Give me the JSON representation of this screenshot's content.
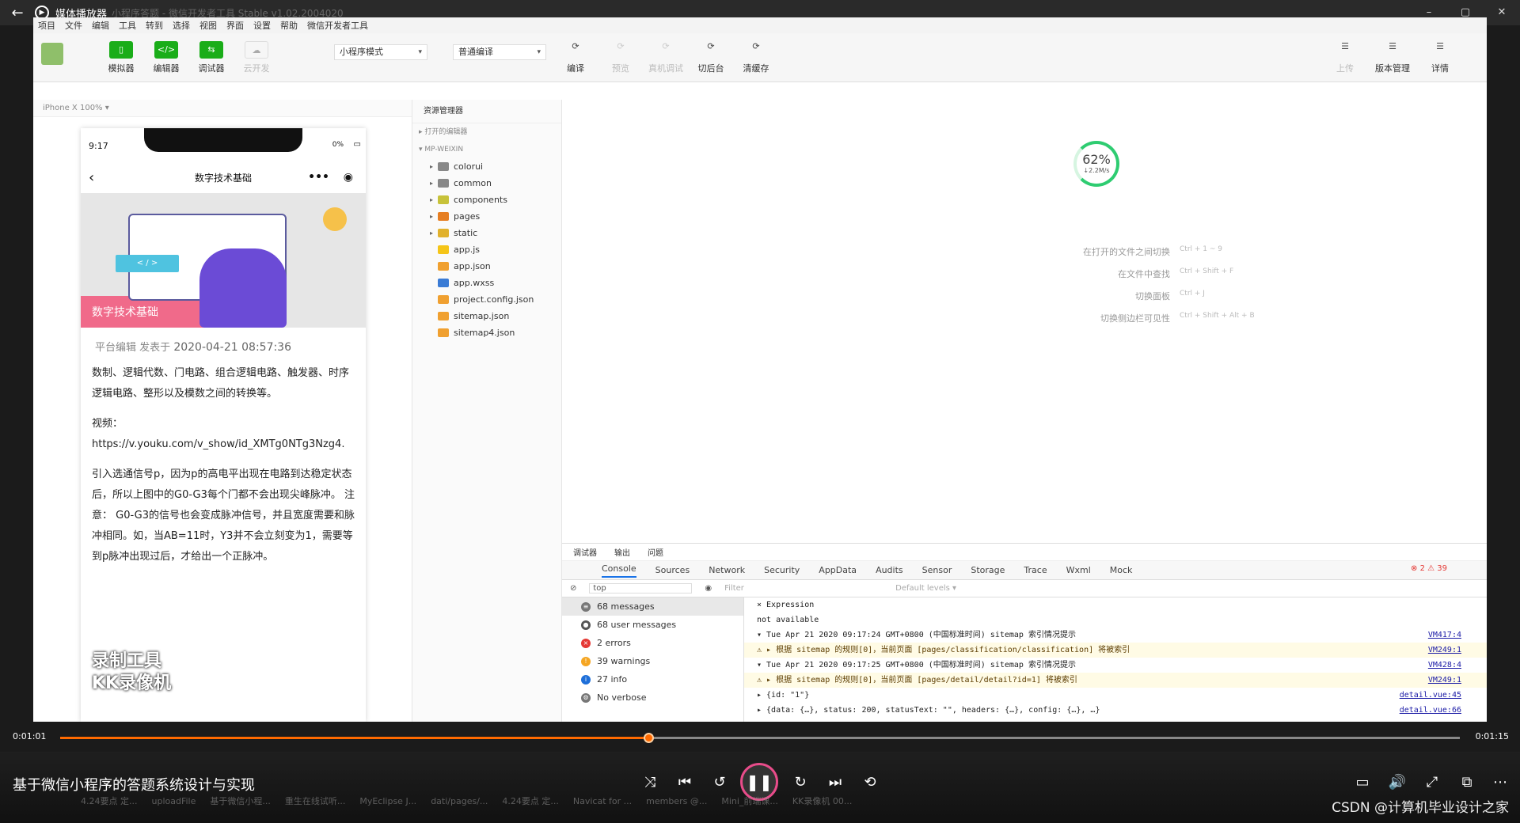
{
  "player": {
    "title": "媒体播放器",
    "ghost_title": "小程序答题 - 微信开发者工具 Stable v1.02.2004020",
    "video_title": "基于微信小程序的答题系统设计与实现",
    "time_current": "0:01:01",
    "time_total": "0:01:15",
    "progress": 0.42,
    "watermark": "CSDN @计算机毕业设计之家"
  },
  "ide": {
    "menu": [
      "项目",
      "文件",
      "编辑",
      "工具",
      "转到",
      "选择",
      "视图",
      "界面",
      "设置",
      "帮助",
      "微信开发者工具"
    ],
    "tools": [
      {
        "label": "模拟器",
        "icon": "▯"
      },
      {
        "label": "编辑器",
        "icon": "</>"
      },
      {
        "label": "调试器",
        "icon": "⇆"
      },
      {
        "label": "云开发",
        "icon": "☁"
      }
    ],
    "mode_select": "小程序模式",
    "compile_select": "普通编译",
    "actions": [
      "编译",
      "预览",
      "真机调试",
      "切后台",
      "清缓存"
    ],
    "right_actions": [
      "上传",
      "版本管理",
      "详情"
    ],
    "device": "iPhone X 100% ▾"
  },
  "phone": {
    "time": "9:17",
    "battery": "0%",
    "nav_title": "数字技术基础",
    "hero_caption": "数字技术基础",
    "author": "平台编辑",
    "published_label": "发表于",
    "published_at": "2020-04-21 08:57:36",
    "para1": "数制、逻辑代数、门电路、组合逻辑电路、触发器、时序逻辑电路、整形以及模数之间的转换等。",
    "video_label": "视频：",
    "video_url": "https://v.youku.com/v_show/id_XMTg0NTg3Nzg4.",
    "para2": "引入选通信号p，因为p的高电平出现在电路到达稳定状态后，所以上图中的G0-G3每个门都不会出现尖峰脉冲。 注意： G0-G3的信号也会变成脉冲信号，并且宽度需要和脉冲相同。如，当AB=11时，Y3并不会立刻变为1，需要等到p脉冲出现过后，才给出一个正脉冲。",
    "overlay_line1": "录制工具",
    "overlay_line2": "KK录像机"
  },
  "explorer": {
    "title": "资源管理器",
    "open_editors": "▸ 打开的编辑器",
    "project": "▾ MP-WEIXIN",
    "items": [
      {
        "name": "colorui",
        "color": "#888",
        "arrow": "▸"
      },
      {
        "name": "common",
        "color": "#888",
        "arrow": "▸"
      },
      {
        "name": "components",
        "color": "#c7c23a",
        "arrow": "▸"
      },
      {
        "name": "pages",
        "color": "#e67e22",
        "arrow": "▸"
      },
      {
        "name": "static",
        "color": "#e1b12c",
        "arrow": "▸"
      },
      {
        "name": "app.js",
        "color": "#f5c518",
        "arrow": ""
      },
      {
        "name": "app.json",
        "color": "#f0a030",
        "arrow": ""
      },
      {
        "name": "app.wxss",
        "color": "#3a7bd5",
        "arrow": ""
      },
      {
        "name": "project.config.json",
        "color": "#f0a030",
        "arrow": ""
      },
      {
        "name": "sitemap.json",
        "color": "#f0a030",
        "arrow": ""
      },
      {
        "name": "sitemap4.json",
        "color": "#f0a030",
        "arrow": ""
      }
    ]
  },
  "editor": {
    "ring_pct": "62%",
    "ring_speed": "↓2.2M/s",
    "shortcuts": [
      {
        "label": "在打开的文件之间切换",
        "keys": "Ctrl + 1 ~ 9"
      },
      {
        "label": "在文件中查找",
        "keys": "Ctrl + Shift + F"
      },
      {
        "label": "切换面板",
        "keys": "Ctrl + J"
      },
      {
        "label": "切换侧边栏可见性",
        "keys": "Ctrl + Shift + Alt + B"
      }
    ]
  },
  "devtools": {
    "top_tabs": [
      "调试器",
      "输出",
      "问题"
    ],
    "tabs": [
      "Console",
      "Sources",
      "Network",
      "Security",
      "AppData",
      "Audits",
      "Sensor",
      "Storage",
      "Trace",
      "Wxml",
      "Mock"
    ],
    "errors_badge": "⊗ 2  ⚠ 39",
    "context": "top",
    "filter_placeholder": "Filter",
    "levels": "Default levels ▾",
    "side": [
      {
        "label": "68 messages",
        "color": "#777",
        "icon": "≡"
      },
      {
        "label": "68 user messages",
        "color": "#555",
        "icon": "●"
      },
      {
        "label": "2 errors",
        "color": "#e53935",
        "icon": "×"
      },
      {
        "label": "39 warnings",
        "color": "#f5a623",
        "icon": "!"
      },
      {
        "label": "27 info",
        "color": "#1e6fd9",
        "icon": "i"
      },
      {
        "label": "No verbose",
        "color": "#777",
        "icon": "⚙"
      }
    ],
    "log": [
      {
        "text": "× Expression",
        "src": "",
        "cls": ""
      },
      {
        "text": "not available",
        "src": "",
        "cls": ""
      },
      {
        "text": "▾ Tue Apr 21 2020 09:17:24 GMT+0800 (中国标准时间) sitemap 索引情况提示",
        "src": "VM417:4",
        "cls": ""
      },
      {
        "text": "⚠ ▸ 根据 sitemap 的规则[0]，当前页面 [pages/classification/classification] 将被索引",
        "src": "VM249:1",
        "cls": "warn"
      },
      {
        "text": "▾ Tue Apr 21 2020 09:17:25 GMT+0800 (中国标准时间) sitemap 索引情况提示",
        "src": "VM428:4",
        "cls": ""
      },
      {
        "text": "⚠ ▸ 根据 sitemap 的规则[0]，当前页面 [pages/detail/detail?id=1] 将被索引",
        "src": "VM249:1",
        "cls": "warn"
      },
      {
        "text": "▸ {id: \"1\"}",
        "src": "detail.vue:45",
        "cls": ""
      },
      {
        "text": "▸ {data: {…}, status: 200, statusText: \"\", headers: {…}, config: {…}, …}",
        "src": "detail.vue:66",
        "cls": ""
      }
    ]
  },
  "taskbar": [
    "4.24要点 定...",
    "uploadFile",
    "基于微信小程...",
    "重生在线试听...",
    "MyEclipse J...",
    "dati/pages/...",
    "4.24要点 定...",
    "Navicat for ...",
    "members @...",
    "Mini_前端课...",
    "KK录像机 00..."
  ]
}
